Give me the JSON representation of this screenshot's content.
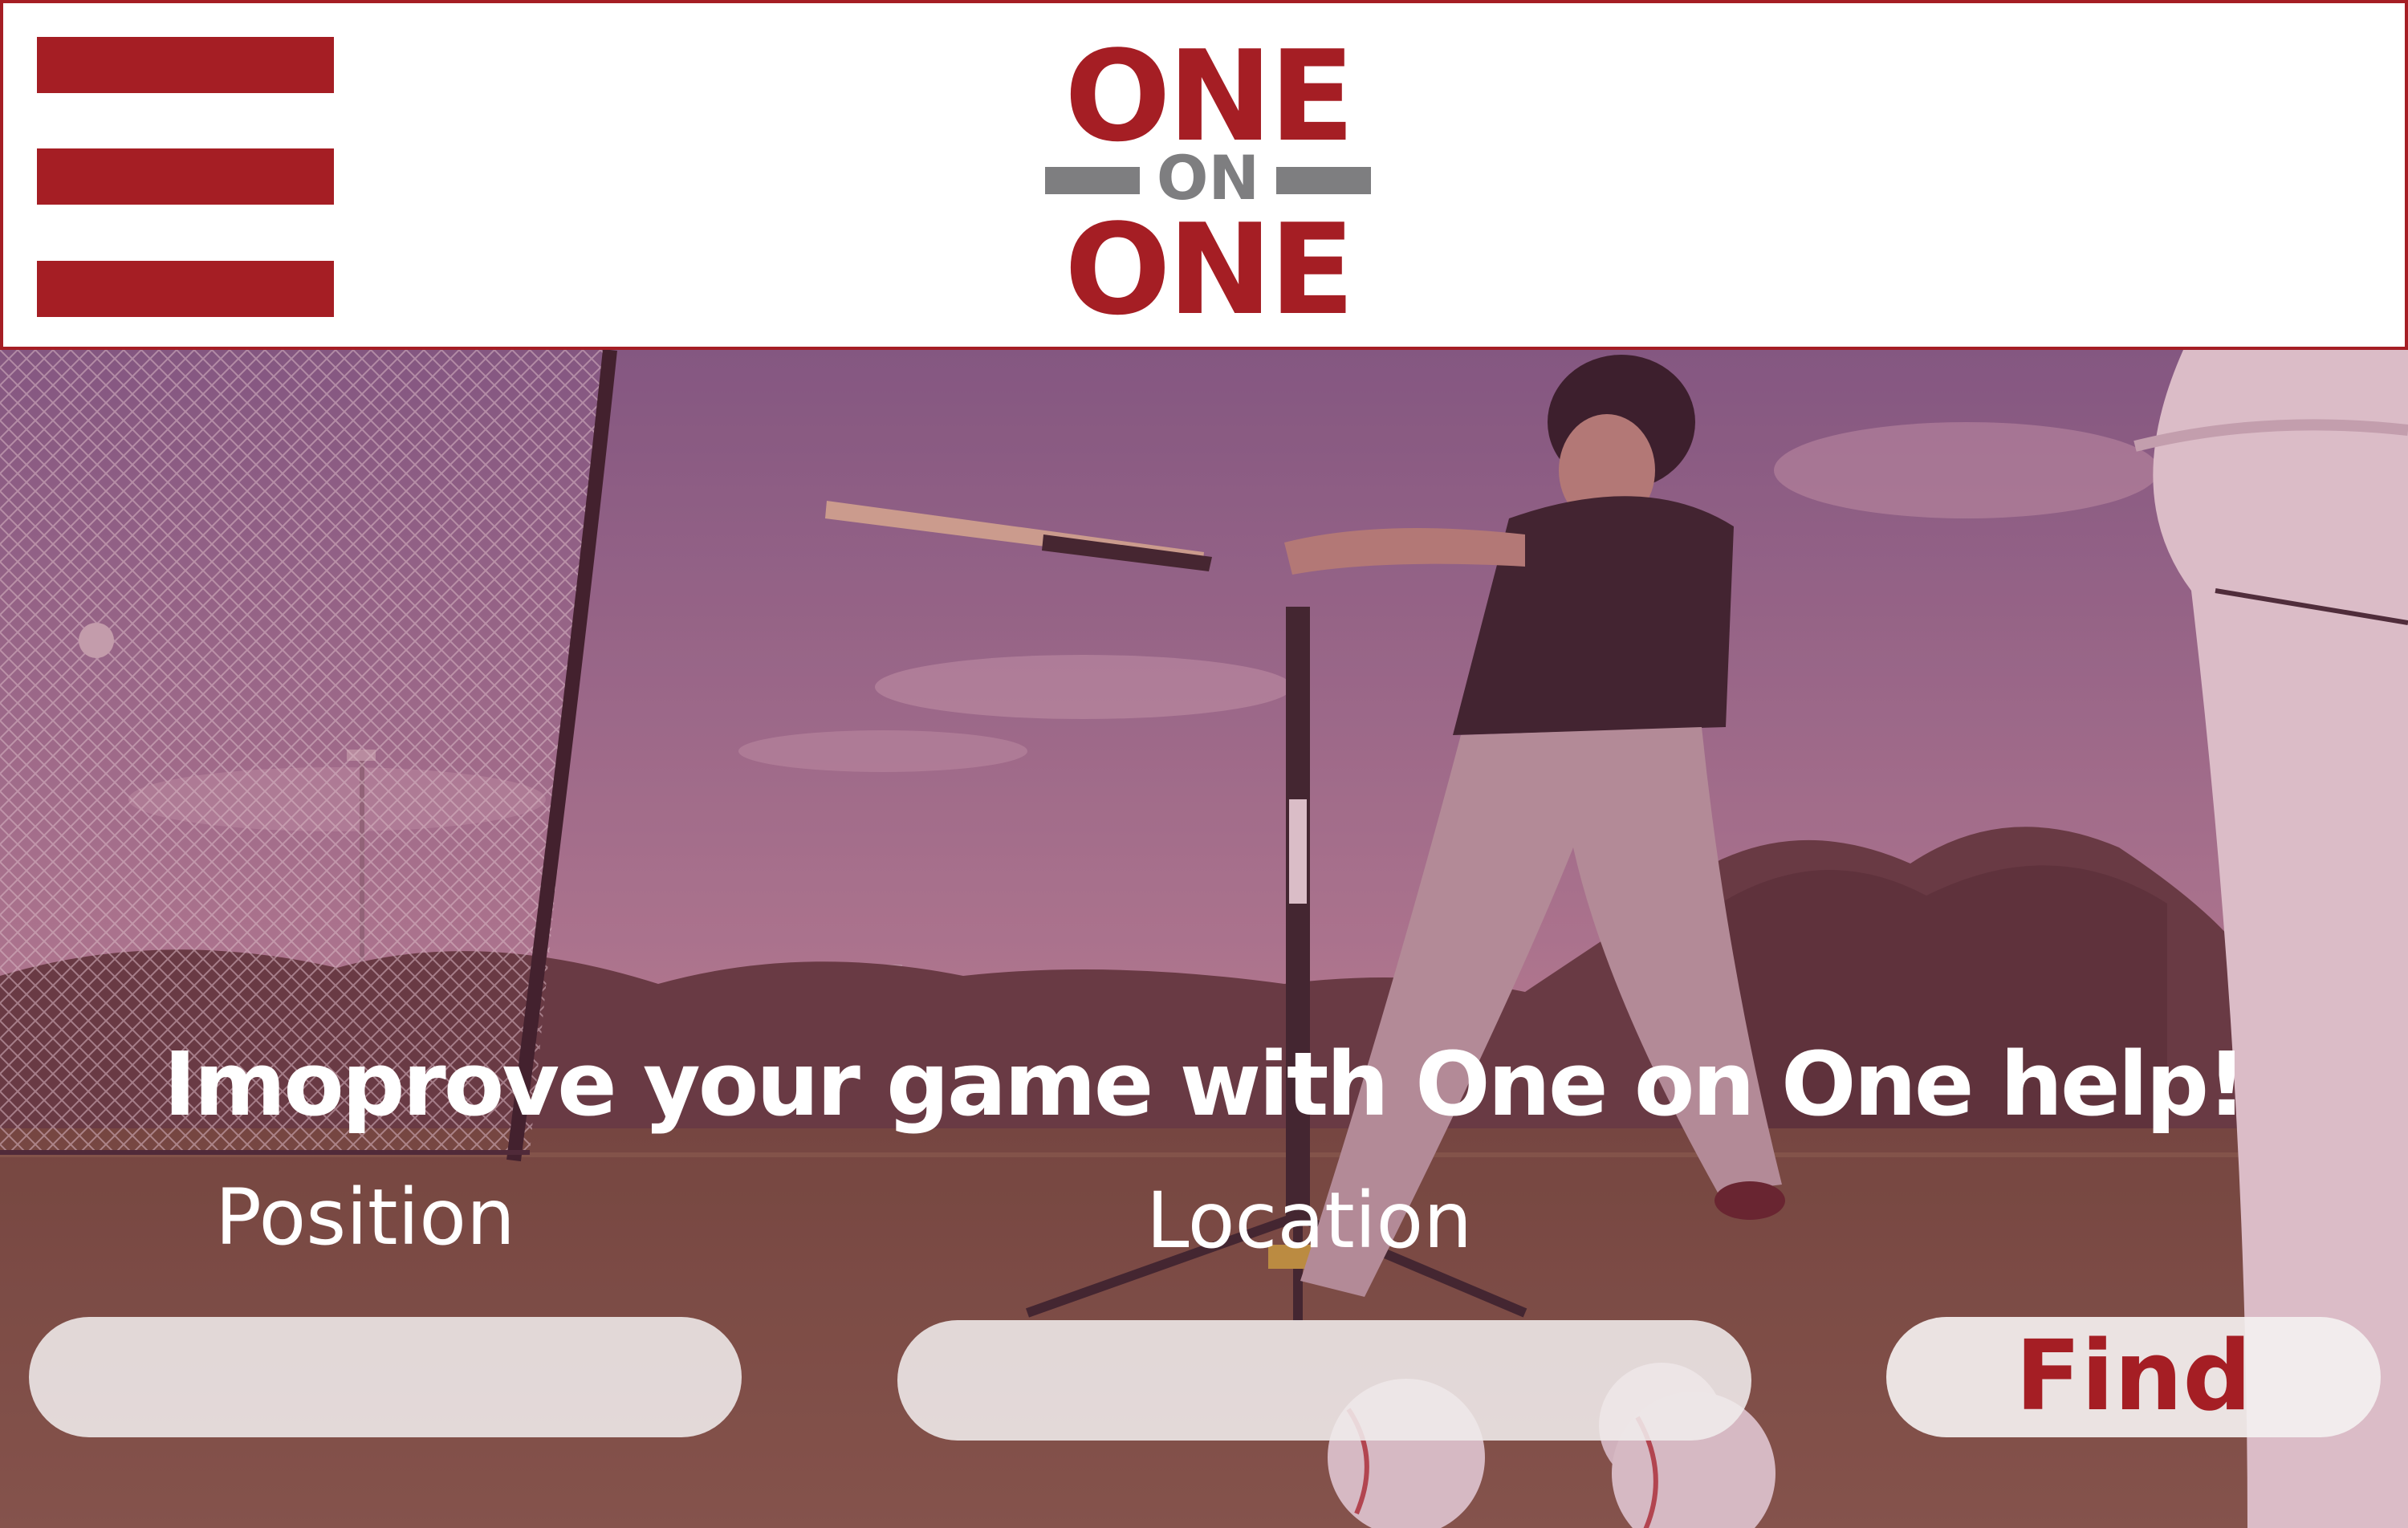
{
  "header": {
    "menu_icon": "hamburger-menu-icon",
    "logo": {
      "top": "ONE",
      "middle": "ON",
      "bottom": "ONE"
    }
  },
  "hero": {
    "headline": "Imoprove your game with One on One help!",
    "position_label": "Position",
    "location_label": "Location",
    "position_value": "",
    "location_value": "",
    "find_label": "Find"
  },
  "colors": {
    "brand_red": "#a51e24",
    "logo_gray": "#7e7e80",
    "overlay": "#a03c5a"
  }
}
